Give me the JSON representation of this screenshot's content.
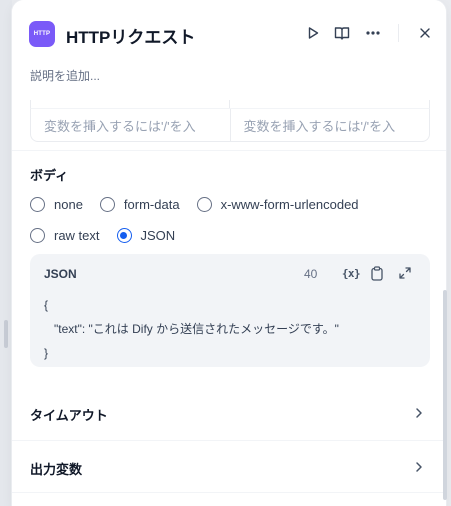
{
  "header": {
    "icon_text": "HTTP",
    "title": "HTTPリクエスト",
    "description_placeholder": "説明を追加..."
  },
  "variables": {
    "placeholders": [
      "変数を挿入するには'/'を入",
      "変数を挿入するには'/'を入"
    ]
  },
  "body_section": {
    "label": "ボディ",
    "options": [
      {
        "label": "none",
        "checked": false
      },
      {
        "label": "form-data",
        "checked": false
      },
      {
        "label": "x-www-form-urlencoded",
        "checked": false
      },
      {
        "label": "raw text",
        "checked": false
      },
      {
        "label": "JSON",
        "checked": true
      }
    ],
    "json_editor": {
      "title": "JSON",
      "count": "40",
      "variable_icon_text": "{x}",
      "lines": [
        "{",
        "\"text\": \"これは Dify から送信されたメッセージです。\"",
        "}"
      ]
    }
  },
  "sections": [
    {
      "label": "タイムアウト"
    },
    {
      "label": "出力変数"
    }
  ],
  "colors": {
    "accent": "#155eef",
    "icon_bg": "#7a5af8"
  }
}
